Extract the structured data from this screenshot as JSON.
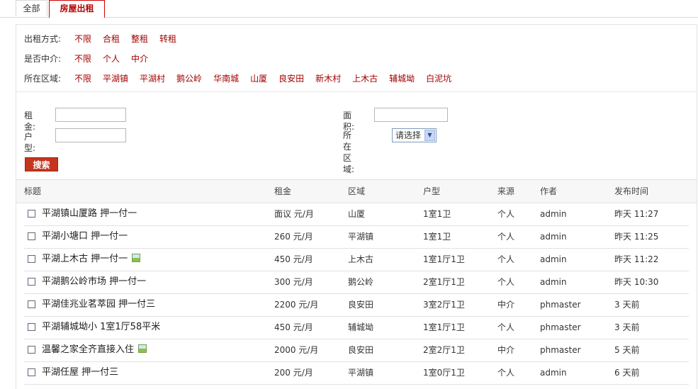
{
  "tabs": [
    {
      "label": "全部"
    },
    {
      "label": "房屋出租"
    }
  ],
  "filters": [
    {
      "label": "出租方式:",
      "options": [
        "不限",
        "合租",
        "整租",
        "转租"
      ]
    },
    {
      "label": "是否中介:",
      "options": [
        "不限",
        "个人",
        "中介"
      ]
    },
    {
      "label": "所在区域:",
      "options": [
        "不限",
        "平湖镇",
        "平湖村",
        "鹅公岭",
        "华南城",
        "山厦",
        "良安田",
        "新木村",
        "上木古",
        "辅城坳",
        "白泥坑"
      ]
    }
  ],
  "search": {
    "rent_label": "租金:",
    "layout_label": "户型:",
    "area_label": "面积:",
    "district_label": "所在区域:",
    "district_value": "请选择",
    "submit_label": "搜索"
  },
  "table": {
    "headers": [
      "标题",
      "租金",
      "区域",
      "户型",
      "来源",
      "作者",
      "发布时间"
    ],
    "rows": [
      {
        "title": "平湖镇山厦路 押一付一",
        "rent": "面议 元/月",
        "district": "山厦",
        "layout": "1室1卫",
        "source": "个人",
        "author": "admin",
        "time": "昨天 11:27",
        "has_image": false
      },
      {
        "title": "平湖小塘口 押一付一",
        "rent": "260 元/月",
        "district": "平湖镇",
        "layout": "1室1卫",
        "source": "个人",
        "author": "admin",
        "time": "昨天 11:25",
        "has_image": false
      },
      {
        "title": "平湖上木古 押一付一",
        "rent": "450 元/月",
        "district": "上木古",
        "layout": "1室1厅1卫",
        "source": "个人",
        "author": "admin",
        "time": "昨天 11:22",
        "has_image": true
      },
      {
        "title": "平湖鹅公岭市场 押一付一",
        "rent": "300 元/月",
        "district": "鹅公岭",
        "layout": "2室1厅1卫",
        "source": "个人",
        "author": "admin",
        "time": "昨天 10:30",
        "has_image": false
      },
      {
        "title": "平湖佳兆业茗萃园 押一付三",
        "rent": "2200 元/月",
        "district": "良安田",
        "layout": "3室2厅1卫",
        "source": "中介",
        "author": "phmaster",
        "time": "3 天前",
        "has_image": false
      },
      {
        "title": "平湖辅城坳小 1室1厅58平米",
        "rent": "450 元/月",
        "district": "辅城坳",
        "layout": "1室1厅1卫",
        "source": "个人",
        "author": "phmaster",
        "time": "3 天前",
        "has_image": false
      },
      {
        "title": "温馨之家全齐直接入住",
        "rent": "2000 元/月",
        "district": "良安田",
        "layout": "2室2厅1卫",
        "source": "中介",
        "author": "phmaster",
        "time": "5 天前",
        "has_image": true
      },
      {
        "title": "平湖任屋 押一付三",
        "rent": "200 元/月",
        "district": "平湖镇",
        "layout": "1室0厅1卫",
        "source": "个人",
        "author": "admin",
        "time": "6 天前",
        "has_image": false
      }
    ]
  }
}
